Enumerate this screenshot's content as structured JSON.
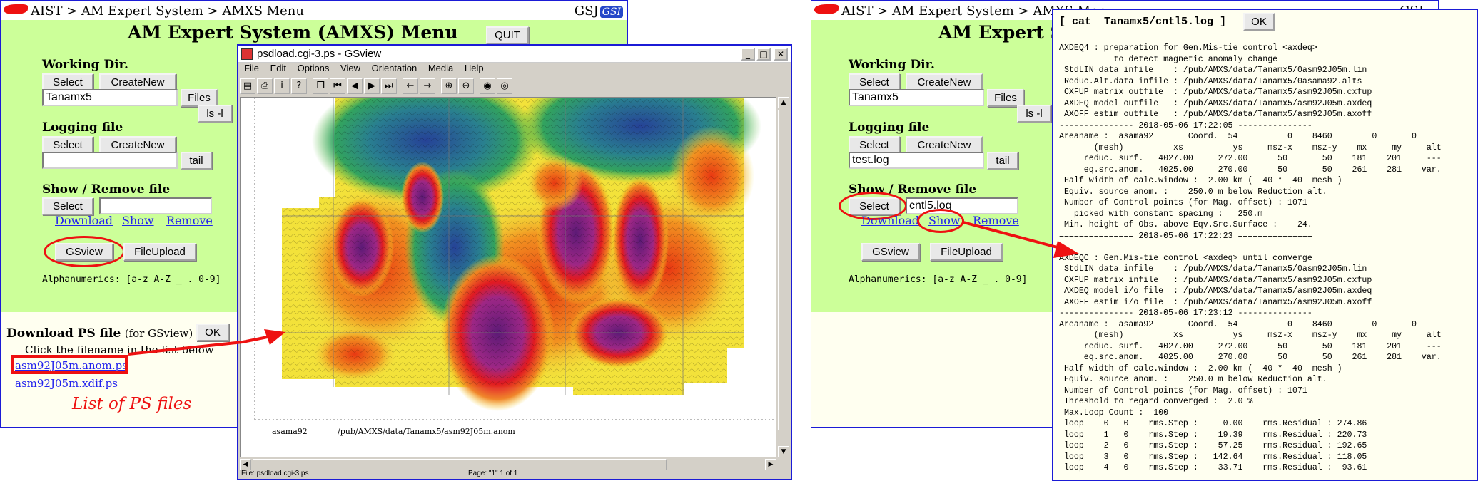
{
  "left_window": {
    "breadcrumb": "AIST > AM Expert System > AMXS Menu",
    "brand": "GSJ",
    "brand_badge": "GSI",
    "heading": "AM Expert System (AMXS) Menu",
    "quit_label": "QUIT",
    "working_dir": {
      "label": "Working Dir.",
      "select_label": "Select",
      "create_label": "CreateNew",
      "value": "Tanamx5",
      "files_label": "Files",
      "ls_label": "ls -l"
    },
    "logging": {
      "label": "Logging file",
      "select_label": "Select",
      "create_label": "CreateNew",
      "value": "",
      "tail_label": "tail"
    },
    "show_remove": {
      "label": "Show / Remove file",
      "select_label": "Select",
      "value": "",
      "download_label": "Download",
      "show_label": "Show",
      "remove_label": "Remove"
    },
    "gsview_label": "GSview",
    "fileupload_label": "FileUpload",
    "alphanumerics": "Alphanumerics:  [a-z A-Z _ . 0-9]",
    "download_ps": {
      "label": "Download PS file",
      "sub": "(for GSview)",
      "ok_label": "OK",
      "instruction": "Click the filename in the list below",
      "files": [
        "asm92J05m.anom.ps",
        "asm92J05m.xdif.ps"
      ],
      "annotation": "List of  PS files"
    }
  },
  "gsview": {
    "title": "psdload.cgi-3.ps - GSview",
    "menu": [
      "File",
      "Edit",
      "Options",
      "View",
      "Orientation",
      "Media",
      "Help"
    ],
    "toolbar_icons": [
      "open-icon",
      "print-icon",
      "info-icon",
      "help-icon",
      "copy-icon",
      "first-page-icon",
      "prev-page-icon",
      "next-page-icon",
      "last-page-icon",
      "back-icon",
      "forward-icon",
      "zoom-in-icon",
      "zoom-out-icon",
      "view-icon",
      "magnify-icon"
    ],
    "toolbar_glyphs": [
      "▤",
      "⎙",
      "i",
      "?",
      "❐",
      "⏮",
      "◀",
      "▶",
      "⏭",
      "←",
      "→",
      "⊕",
      "⊖",
      "◉",
      "◎"
    ],
    "caption_left": "asama92",
    "caption_right": "/pub/AMXS/data/Tanamx5/asm92J05m.anom",
    "status_file": "File: psdload.cgi-3.ps",
    "status_page": "Page: \"1\"  1 of 1"
  },
  "right_window": {
    "breadcrumb": "AIST > AM Expert System > AMXS Menu",
    "brand": "GSJ",
    "heading": "AM Expert Sy",
    "working_dir": {
      "label": "Working Dir.",
      "select_label": "Select",
      "create_label": "CreateNew",
      "value": "Tanamx5",
      "files_label": "Files",
      "ls_label": "ls -l"
    },
    "logging": {
      "label": "Logging file",
      "select_label": "Select",
      "create_label": "CreateNew",
      "value": "test.log",
      "tail_label": "tail"
    },
    "show_remove": {
      "label": "Show / Remove file",
      "select_label": "Select",
      "value": "cntl5.log",
      "download_label": "Download",
      "show_label": "Show",
      "remove_label": "Remove"
    },
    "gsview_label": "GSview",
    "fileupload_label": "FileUpload",
    "alphanumerics": "Alphanumerics:  [a-z A-Z _ . 0-9]"
  },
  "log_window": {
    "command": "[ cat  Tanamx5/cntl5.log ]",
    "ok_label": "OK",
    "text": "AXDEQ4 : preparation for Gen.Mis-tie control <axdeq>\n           to detect magnetic anomaly change\n StdLIN data infile    : /pub/AMXS/data/Tanamx5/0asm92J05m.lin\n Reduc.Alt.data infile : /pub/AMXS/data/Tanamx5/0asama92.alts\n CXFUP matrix outfile  : /pub/AMXS/data/Tanamx5/asm92J05m.cxfup\n AXDEQ model outfile   : /pub/AMXS/data/Tanamx5/asm92J05m.axdeq\n AXOFF estim outfile   : /pub/AMXS/data/Tanamx5/asm92J05m.axoff\n--------------- 2018-05-06 17:22:05 ---------------\nAreaname :  asama92       Coord.  54          0    8460        0       0\n       (mesh)          xs          ys     msz-x    msz-y    mx     my     alt\n     reduc. surf.   4027.00     272.00      50       50    181    201     ---\n     eq.src.anom.   4025.00     270.00      50       50    261    281    var.\n Half width of calc.window :  2.00 km (  40 *  40  mesh )\n Equiv. source anom. :    250.0 m below Reduction alt.\n Number of Control points (for Mag. offset) : 1071\n   picked with constant spacing :   250.m\n Min. height of Obs. above Eqv.Src.Surface :    24.\n=============== 2018-05-06 17:22:23 ===============\n\nAXDEQC : Gen.Mis-tie control <axdeq> until converge\n StdLIN data infile    : /pub/AMXS/data/Tanamx5/0asm92J05m.lin\n CXFUP matrix infile   : /pub/AMXS/data/Tanamx5/asm92J05m.cxfup\n AXDEQ model i/o file  : /pub/AMXS/data/Tanamx5/asm92J05m.axdeq\n AXOFF estim i/o file  : /pub/AMXS/data/Tanamx5/asm92J05m.axoff\n--------------- 2018-05-06 17:23:12 ---------------\nAreaname :  asama92       Coord.  54          0    8460        0       0\n       (mesh)          xs          ys     msz-x    msz-y    mx     my     alt\n     reduc. surf.   4027.00     272.00      50       50    181    201     ---\n     eq.src.anom.   4025.00     270.00      50       50    261    281    var.\n Half width of calc.window :  2.00 km (  40 *  40  mesh )\n Equiv. source anom. :    250.0 m below Reduction alt.\n Number of Control points (for Mag. offset) : 1071\n Threshold to regard converged :  2.0 %\n Max.Loop Count :  100\n loop    0   0    rms.Step :     0.00    rms.Residual : 274.86\n loop    1   0    rms.Step :    19.39    rms.Residual : 220.73\n loop    2   0    rms.Step :    57.25    rms.Residual : 192.65\n loop    3   0    rms.Step :   142.64    rms.Residual : 118.05\n loop    4   0    rms.Step :    33.71    rms.Residual :  93.61"
  },
  "colors": {
    "panel_green": "#ccff99",
    "border_blue": "#1b1bd6",
    "annotation_red": "#ee1111",
    "link_blue": "#2222ee",
    "log_bg": "#fffff0"
  }
}
